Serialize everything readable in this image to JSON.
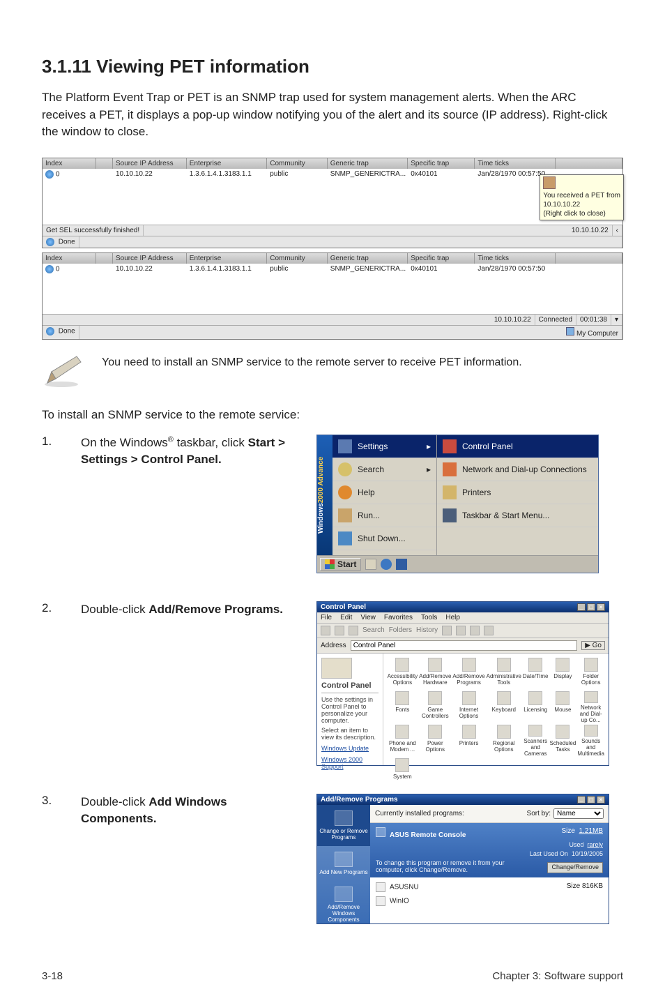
{
  "heading": "3.1.11    Viewing PET information",
  "intro": "The Platform Event Trap or PET is an SNMP trap used for system management alerts. When the ARC receives a PET, it displays a pop-up window notifying you of the alert and its source (IP address). Right-click the window to close.",
  "pet_headers": [
    "Index",
    "",
    "Source IP Address",
    "Enterprise",
    "Community",
    "Generic trap",
    "Specific trap",
    "Time ticks",
    ""
  ],
  "pet1": {
    "index": "0",
    "source_ip": "10.10.10.22",
    "enterprise": "1.3.6.1.4.1.3183.1.1",
    "community": "public",
    "generic_trap": "SNMP_GENERICTRA...",
    "specific_trap": "0x40101",
    "time_ticks": "Jan/28/1970 00:57:50",
    "status_left": "Get SEL successfully finished!",
    "status_ip": "10.10.10.22",
    "done": "Done",
    "tooltip_l1": "You received a PET from",
    "tooltip_l2": "10.10.10.22",
    "tooltip_l3": "(Right click to close)"
  },
  "pet2": {
    "index": "0",
    "source_ip": "10.10.10.22",
    "enterprise": "1.3.6.1.4.1.3183.1.1",
    "community": "public",
    "generic_trap": "SNMP_GENERICTRA...",
    "specific_trap": "0x40101",
    "time_ticks": "Jan/28/1970 00:57:50",
    "status_ip": "10.10.10.22",
    "status_conn": "Connected",
    "status_time": "00:01:38",
    "done": "Done",
    "done_right": "My Computer"
  },
  "note": "You need to install an SNMP service to the remote server to receive PET information.",
  "section_lead": "To install an SNMP service to the remote service:",
  "step1": {
    "num": "1.",
    "pre": "On the Windows",
    "sup": "®",
    "post": " taskbar, click ",
    "bold": "Start > Settings > Control Panel."
  },
  "start_menu": {
    "sidebar_brand1": "Windows",
    "sidebar_brand2": "2000 Advance",
    "left": [
      "Settings",
      "Search",
      "Help",
      "Run...",
      "Shut Down..."
    ],
    "right": [
      "Control Panel",
      "Network and Dial-up Connections",
      "Printers",
      "Taskbar & Start Menu..."
    ],
    "start_label": "Start"
  },
  "step2": {
    "num": "2.",
    "pre": "Double-click ",
    "bold": "Add/Remove Programs."
  },
  "control_panel": {
    "title": "Control Panel",
    "menu": [
      "File",
      "Edit",
      "View",
      "Favorites",
      "Tools",
      "Help"
    ],
    "toolbar_items": [
      "Back",
      "Search",
      "Folders",
      "History"
    ],
    "address_label": "Address",
    "address_value": "Control Panel",
    "go": "Go",
    "left_header": "Control Panel",
    "left_text1": "Use the settings in Control Panel to personalize your computer.",
    "left_text2": "Select an item to view its description.",
    "left_link1": "Windows Update",
    "left_link2": "Windows 2000 Support",
    "icons": [
      "Accessibility Options",
      "Add/Remove Hardware",
      "Add/Remove Programs",
      "Administrative Tools",
      "Date/Time",
      "Display",
      "Folder Options",
      "Fonts",
      "Game Controllers",
      "Internet Options",
      "Keyboard",
      "Licensing",
      "Mouse",
      "Network and Dial-up Co...",
      "Phone and Modem ...",
      "Power Options",
      "Printers",
      "Regional Options",
      "Scanners and Cameras",
      "Scheduled Tasks",
      "Sounds and Multimedia",
      "System"
    ]
  },
  "step3": {
    "num": "3.",
    "pre": "Double-click ",
    "bold": "Add Windows Components."
  },
  "arp": {
    "title": "Add/Remove Programs",
    "side": [
      "Change or Remove Programs",
      "Add New Programs",
      "Add/Remove Windows Components"
    ],
    "currently": "Currently installed programs:",
    "sort_label": "Sort by:",
    "sort_value": "Name",
    "selected_name": "ASUS Remote Console",
    "selected_size_lbl": "Size",
    "selected_size": "1.21MB",
    "selected_used_lbl": "Used",
    "selected_used": "rarely",
    "selected_last_lbl": "Last Used On",
    "selected_last": "10/19/2005",
    "selected_hint": "To change this program or remove it from your computer, click Change/Remove.",
    "selected_btn": "Change/Remove",
    "items": [
      {
        "name": "ASUSNU",
        "size_lbl": "Size",
        "size": "816KB"
      },
      {
        "name": "WinIO",
        "size_lbl": "",
        "size": ""
      }
    ]
  },
  "footer_left": "3-18",
  "footer_right": "Chapter 3: Software support"
}
